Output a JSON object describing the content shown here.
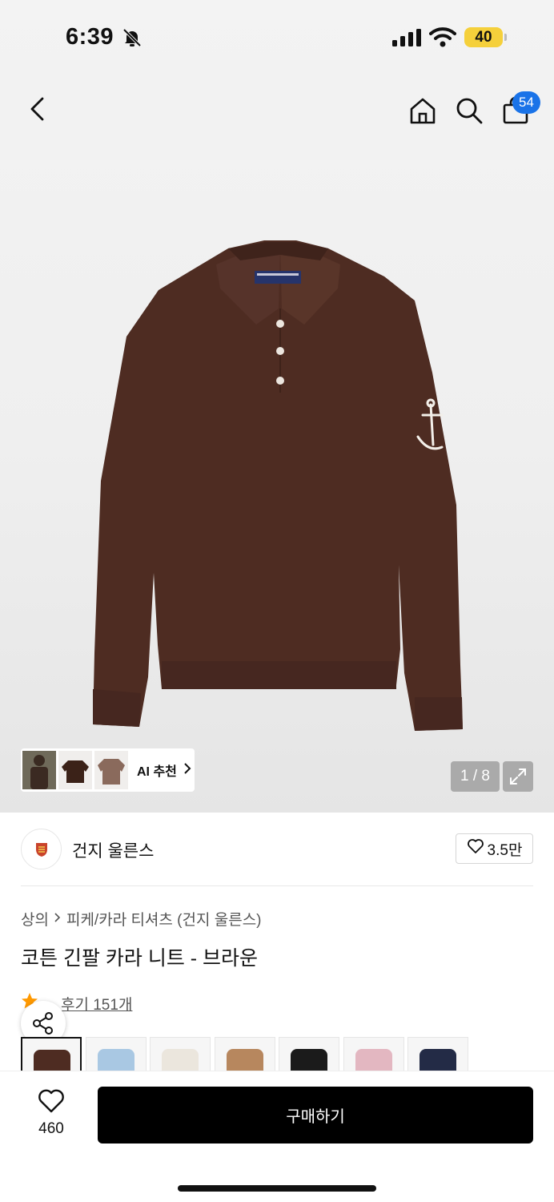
{
  "status_bar": {
    "time": "6:39",
    "battery": "40",
    "icons": [
      "bell-off-icon",
      "signal-icon",
      "wifi-icon",
      "battery-icon"
    ]
  },
  "nav": {
    "cart_count": "54",
    "icons": [
      "back-icon",
      "home-icon",
      "search-icon",
      "shopping-bag-icon"
    ]
  },
  "gallery": {
    "counter": "1 / 8",
    "ai_recommend_label": "AI 추천",
    "product_color": "#4e2c22"
  },
  "brand": {
    "name": "건지 울른스",
    "likes": "3.5만"
  },
  "breadcrumb": {
    "category": "상의",
    "subcategory": "피케/카라 티셔츠 (건지 울른스)"
  },
  "product": {
    "title": "코튼 긴팔 카라 니트 - 브라운"
  },
  "rating": {
    "review_link": "후기 151개"
  },
  "color_options": {
    "swatches": [
      "#4e2c22",
      "#a9c8e3",
      "#ebe6dd",
      "#b7875e",
      "#1b1b1b",
      "#e3b7c1",
      "#232b46"
    ]
  },
  "bottom_bar": {
    "wish_count": "460",
    "buy_label": "구매하기"
  },
  "colors": {
    "accent_badge": "#1a73e8",
    "battery": "#f5d03b",
    "star": "#ff9900",
    "buy_button": "#000000"
  }
}
